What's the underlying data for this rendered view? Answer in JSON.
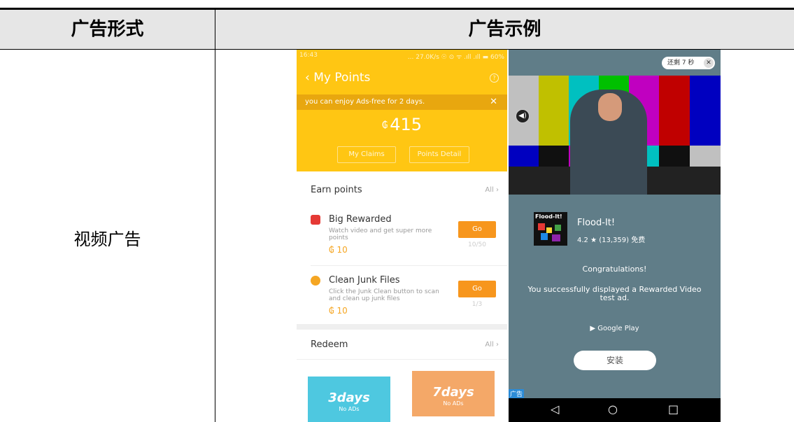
{
  "table": {
    "col1_header": "广告形式",
    "col2_header": "广告示例",
    "row1_label": "视频广告"
  },
  "left_screen": {
    "status_time": "16:43",
    "status_right": "... 27.0K/s ☉ ⊙ ᯤ .ıll .ıll ▬ 60%",
    "title": "‹ My Points",
    "help_icon": "?",
    "banner": "you can enjoy Ads-free for 2 days.",
    "banner_close": "✕",
    "points": "415",
    "coin_icon": "₲",
    "btn_claims": "My Claims",
    "btn_detail": "Points Detail",
    "earn_title": "Earn points",
    "all_label": "All  ›",
    "tasks": [
      {
        "title": "Big Rewarded",
        "desc": "Watch video and get super more points",
        "points": "₲ 10",
        "go": "Go",
        "progress": "10/50"
      },
      {
        "title": "Clean Junk Files",
        "desc": "Click the Junk Clean button to scan and clean up junk files",
        "points": "₲ 10",
        "go": "Go",
        "progress": "1/3"
      }
    ],
    "redeem_title": "Redeem",
    "redeem_all": "All  ›",
    "cards": [
      {
        "title": "3days",
        "sub": "No ADs",
        "color": "#4ec8e0"
      },
      {
        "title": "7days",
        "sub": "No ADs",
        "color": "#f4a868"
      }
    ],
    "colors": {
      "accent": "#ffc613",
      "button": "#f7961d"
    }
  },
  "right_screen": {
    "skip_text": "还剩 7 秒",
    "skip_close": "✕",
    "sound_icon": "◀)",
    "app_icon_text": "Flood-It!",
    "app_name": "Flood-It!",
    "app_rating": "4.2 ★ (13,359) 免费",
    "congrats": "Congratulations!",
    "message": "You successfully displayed a Rewarded Video test ad.",
    "google_play": "▶ Google Play",
    "install": "安装",
    "ad_tag": "广告",
    "nav": [
      "◁",
      "○",
      "□"
    ]
  }
}
